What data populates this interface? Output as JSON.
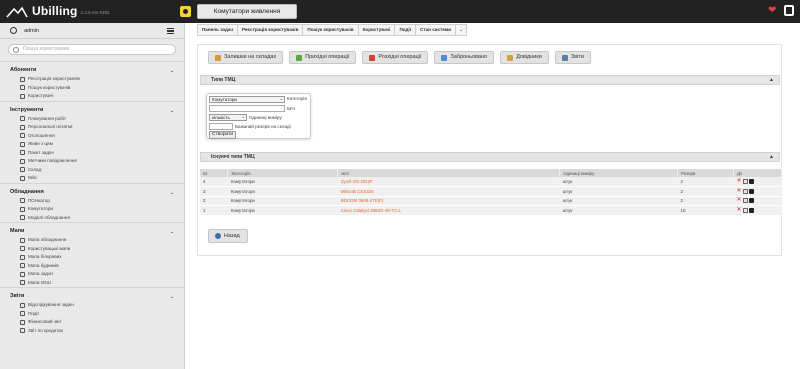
{
  "app": {
    "name": "Ubilling",
    "version": "1.4.9 rev 9192"
  },
  "topbar": {
    "module_title": "Комутатори живлення"
  },
  "sidebar": {
    "user": "admin",
    "search_placeholder": "Пошук користувачів",
    "sections": [
      {
        "title": "Абоненти",
        "items": [
          "Реєстрація користувачів",
          "Пошук користувачів",
          "Користувачі"
        ]
      },
      {
        "title": "Інструменти",
        "items": [
          "Планування робіт",
          "Персональні нотатки",
          "Оголошення",
          "Живе з цим",
          "Пакет задач",
          "Метчики повідомлення",
          "Склад",
          "Wiki"
        ]
      },
      {
        "title": "Обладнання",
        "items": [
          "ПОНкатор",
          "Комутатори",
          "Моделі обладнання"
        ]
      },
      {
        "title": "Мапи",
        "items": [
          "Мапа обладнання",
          "Користувацькі мапи",
          "Мапа білкравих",
          "Мапа будинків",
          "Мапа задач",
          "Мапа ONU"
        ]
      },
      {
        "title": "Звіти",
        "items": [
          "Відслідкування задач",
          "Події",
          "Фінансовий звіт",
          "Звіт по кредитах"
        ]
      }
    ]
  },
  "breadcrumbs": [
    "Панель задач",
    "Реєстрація користувачів",
    "Пошук користувачів",
    "Користувачі",
    "Події",
    "Стан системи",
    "⌄"
  ],
  "actions": [
    {
      "label": "Залишки на складах",
      "color": "#d59a38"
    },
    {
      "label": "Прихідні операції",
      "color": "#5aa845"
    },
    {
      "label": "Розхідні операції",
      "color": "#d0442f"
    },
    {
      "label": "Заброньовано",
      "color": "#4e8ccf"
    },
    {
      "label": "Довідники",
      "color": "#d3a13b"
    },
    {
      "label": "Звіти",
      "color": "#5d7fa6"
    }
  ],
  "panel_types": {
    "title": "Типи ТМЦ",
    "arrow": "▲"
  },
  "form": {
    "category_value": "Комутатори",
    "category_label": "Категорія",
    "name_label": "Ім'я",
    "unit_value": "кількість",
    "unit_label": "Одиниці виміру",
    "reserve_label": "Бажаний резерв на складі",
    "create_button": "Створити"
  },
  "panel_existing": {
    "title": "Існуючі типи ТМЦ",
    "arrow": "▲"
  },
  "table": {
    "headers": [
      "ID",
      "Категорія",
      "Ім'я",
      "Одиниці виміру",
      "Резерв",
      "Дії"
    ],
    "rows": [
      [
        "4",
        "Комутатори",
        "Zyxel GS-3012F",
        "штук",
        "2"
      ],
      [
        "3",
        "Комутатори",
        "Mikrotik CSS326",
        "штук",
        "2"
      ],
      [
        "2",
        "Комутатори",
        "BDCOM 3608-2TE(F)",
        "штук",
        "2"
      ],
      [
        "1",
        "Комутатори",
        "Cisco Catalyst 2960G-48-TC-L",
        "штук",
        "10"
      ]
    ]
  },
  "back_button": "Назад",
  "colors": {
    "topbar": "#222222",
    "link": "#e2672b",
    "delete": "#d42a2a"
  }
}
